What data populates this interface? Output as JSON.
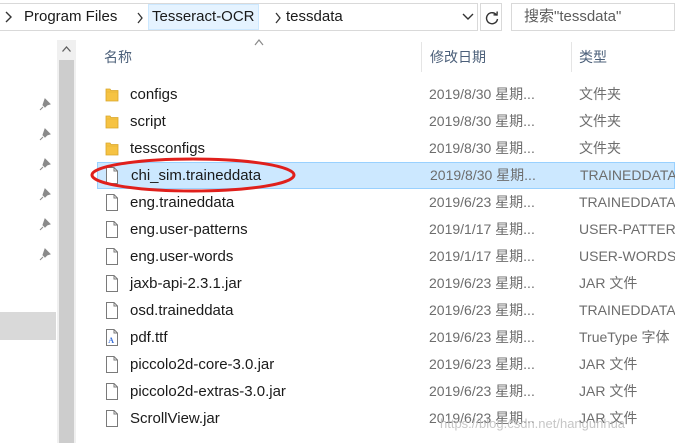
{
  "address_bar": {
    "crumbs": [
      "Program Files",
      "Tesseract-OCR",
      "tessdata"
    ]
  },
  "search": {
    "placeholder": "搜索\"tessdata\""
  },
  "columns": {
    "name": "名称",
    "date": "修改日期",
    "type": "类型"
  },
  "files": [
    {
      "name": "configs",
      "date": "2019/8/30 星期...",
      "type": "文件夹",
      "kind": "folder"
    },
    {
      "name": "script",
      "date": "2019/8/30 星期...",
      "type": "文件夹",
      "kind": "folder"
    },
    {
      "name": "tessconfigs",
      "date": "2019/8/30 星期...",
      "type": "文件夹",
      "kind": "folder"
    },
    {
      "name": "chi_sim.traineddata",
      "date": "2019/8/30 星期...",
      "type": "TRAINEDDATA",
      "kind": "file",
      "selected": true,
      "annotated": true
    },
    {
      "name": "eng.traineddata",
      "date": "2019/6/23 星期...",
      "type": "TRAINEDDATA",
      "kind": "file"
    },
    {
      "name": "eng.user-patterns",
      "date": "2019/1/17 星期...",
      "type": "USER-PATTERNS",
      "kind": "file"
    },
    {
      "name": "eng.user-words",
      "date": "2019/1/17 星期...",
      "type": "USER-WORDS",
      "kind": "file"
    },
    {
      "name": "jaxb-api-2.3.1.jar",
      "date": "2019/6/23 星期...",
      "type": "JAR 文件",
      "kind": "file"
    },
    {
      "name": "osd.traineddata",
      "date": "2019/6/23 星期...",
      "type": "TRAINEDDATA",
      "kind": "file"
    },
    {
      "name": "pdf.ttf",
      "date": "2019/6/23 星期...",
      "type": "TrueType 字体",
      "kind": "font"
    },
    {
      "name": "piccolo2d-core-3.0.jar",
      "date": "2019/6/23 星期...",
      "type": "JAR 文件",
      "kind": "file"
    },
    {
      "name": "piccolo2d-extras-3.0.jar",
      "date": "2019/6/23 星期...",
      "type": "JAR 文件",
      "kind": "file"
    },
    {
      "name": "ScrollView.jar",
      "date": "2019/6/23 星期...",
      "type": "JAR 文件",
      "kind": "file"
    }
  ],
  "watermark": "https://blog.csdn.net/hangunhua",
  "colors": {
    "selection_bg": "#cce8ff",
    "selection_border": "#99d1ff",
    "annotation_red": "#e0201c",
    "folder_yellow": "#f6c343"
  }
}
